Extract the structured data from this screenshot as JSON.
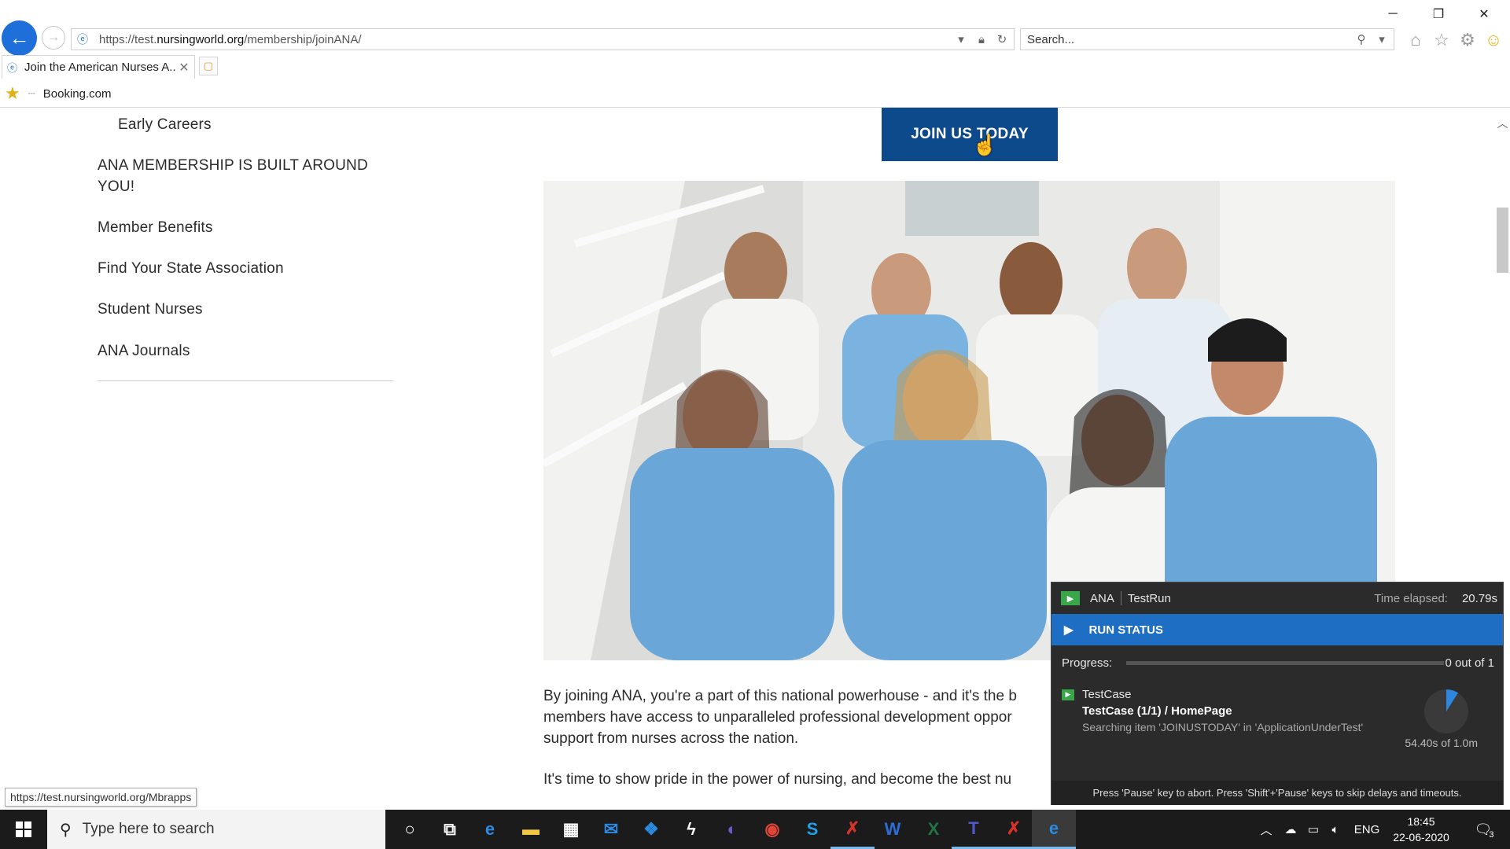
{
  "browser": {
    "url_prefix": "https://test.",
    "url_host": "nursingworld.org",
    "url_path": "/membership/joinANA/",
    "search_placeholder": "Search...",
    "tab_label": "Join the American Nurses A...",
    "tab_close": "✕",
    "favorites": [
      {
        "label": "Booking.com"
      }
    ],
    "status_url": "https://test.nursingworld.org/Mbrapps",
    "window_controls": {
      "minimize": "─",
      "restore": "❐",
      "close": "✕"
    }
  },
  "page": {
    "nav_items": [
      {
        "label": "Early Careers"
      },
      {
        "label": "ANA MEMBERSHIP IS BUILT AROUND YOU!"
      },
      {
        "label": "Member Benefits"
      },
      {
        "label": "Find Your State Association"
      },
      {
        "label": "Student Nurses"
      },
      {
        "label": "ANA Journals"
      }
    ],
    "cta_label": "JOIN US TODAY",
    "paragraphs": [
      "By joining ANA, you're a part of this national powerhouse - and it's the b",
      "members have access to unparalleled professional development oppor",
      "support from nurses across the nation.",
      "It's time to show pride in the power of nursing, and become the best nu"
    ]
  },
  "runner": {
    "project": "ANA",
    "run_name": "TestRun",
    "elapsed_label": "Time elapsed:",
    "elapsed": "20.79s",
    "status_title": "RUN STATUS",
    "progress_label": "Progress:",
    "progress_fraction": 0,
    "progress_count": "0 out of 1",
    "case_label": "TestCase",
    "case_title": "TestCase (1/1) / HomePage",
    "case_message": "Searching item 'JOINUSTODAY' in 'ApplicationUnderTest'",
    "case_time": "54.40s of 1.0m",
    "case_time_fraction": 0.09,
    "footer": "Press 'Pause' key to abort. Press 'Shift'+'Pause' keys to skip delays and timeouts.",
    "colors": {
      "accent": "#1e6fc4",
      "background": "#2b2b2b",
      "ok": "#3aa64a"
    }
  },
  "taskbar": {
    "search_placeholder": "Type here to search",
    "language": "ENG",
    "time": "18:45",
    "date": "22-06-2020",
    "notification_count": "3",
    "apps": [
      {
        "name": "cortana-icon",
        "glyph": "○"
      },
      {
        "name": "task-view-icon",
        "glyph": "⧉"
      },
      {
        "name": "edge-icon",
        "glyph": "e"
      },
      {
        "name": "file-explorer-icon",
        "glyph": "▬"
      },
      {
        "name": "store-icon",
        "glyph": "▦"
      },
      {
        "name": "mail-icon",
        "glyph": "✉"
      },
      {
        "name": "dropbox-icon",
        "glyph": "❖"
      },
      {
        "name": "app-lightning-icon",
        "glyph": "ϟ"
      },
      {
        "name": "eclipse-icon",
        "glyph": "◐"
      },
      {
        "name": "chrome-icon",
        "glyph": "◉"
      },
      {
        "name": "skype-icon",
        "glyph": "S"
      },
      {
        "name": "ranorex-icon",
        "glyph": "✗"
      },
      {
        "name": "word-icon",
        "glyph": "W"
      },
      {
        "name": "excel-icon",
        "glyph": "X"
      },
      {
        "name": "teams-icon",
        "glyph": "T"
      },
      {
        "name": "ranorex-recorder-icon",
        "glyph": "✗"
      },
      {
        "name": "internet-explorer-icon",
        "glyph": "e"
      }
    ]
  }
}
